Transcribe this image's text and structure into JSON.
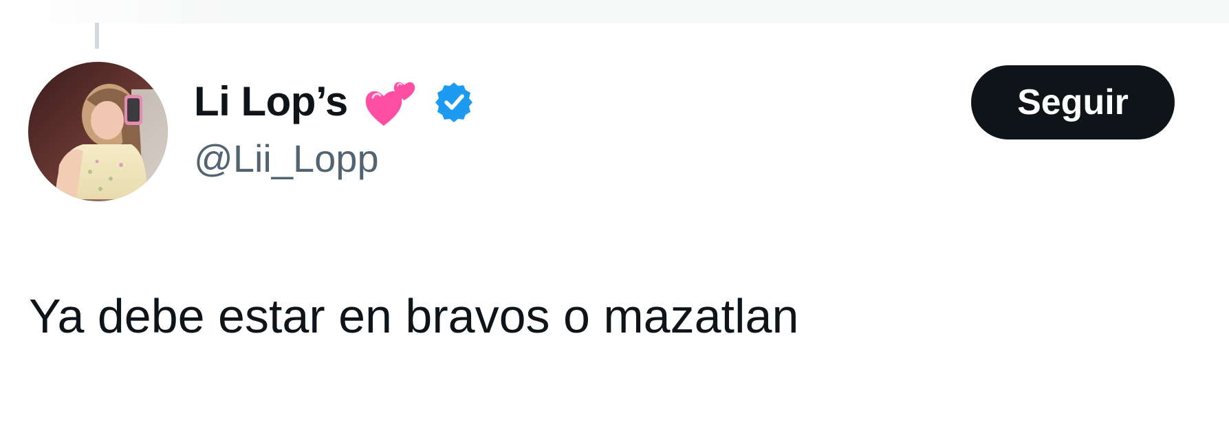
{
  "tweet": {
    "author": {
      "display_name": "Li Lop’s",
      "handle": "@Lii_Lopp",
      "name_emoji_icon": "two-hearts-icon",
      "verified_icon": "verified-badge-icon",
      "verified_color": "#1d9bf0"
    },
    "follow_button": {
      "label": "Seguir",
      "background": "#0f1419",
      "text_color": "#ffffff"
    },
    "text": "Ya debe estar en bravos o mazatlan"
  },
  "colors": {
    "primary_text": "#0f1419",
    "secondary_text": "#536471",
    "thread_line": "#cfd9de",
    "heart_pink": "#ff4fa3"
  }
}
